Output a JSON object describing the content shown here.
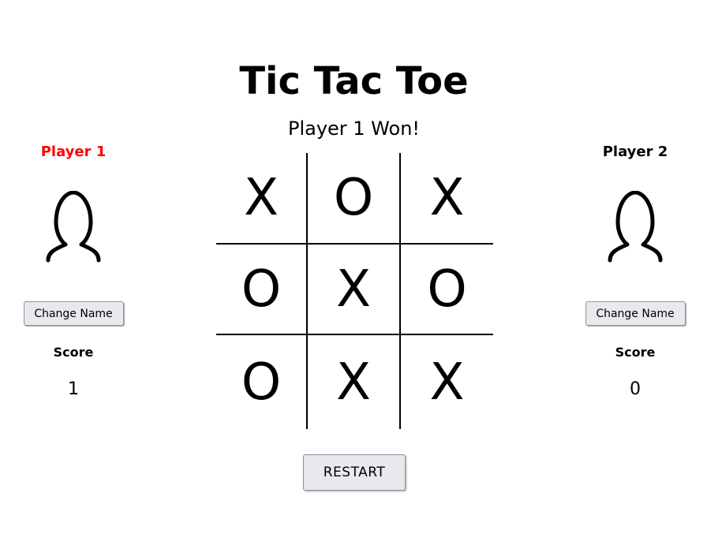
{
  "title": "Tic Tac Toe",
  "status": "Player 1 Won!",
  "players": [
    {
      "name": "Player 1",
      "name_color": "#ff0000",
      "avatar_icon": "user-outline-icon",
      "change_name_label": "Change Name",
      "score_label": "Score",
      "score": "1"
    },
    {
      "name": "Player 2",
      "name_color": "#000000",
      "avatar_icon": "user-outline-icon",
      "change_name_label": "Change Name",
      "score_label": "Score",
      "score": "0"
    }
  ],
  "board": [
    [
      "X",
      "O",
      "X"
    ],
    [
      "O",
      "X",
      "O"
    ],
    [
      "O",
      "X",
      "X"
    ]
  ],
  "restart_label": "RESTART"
}
